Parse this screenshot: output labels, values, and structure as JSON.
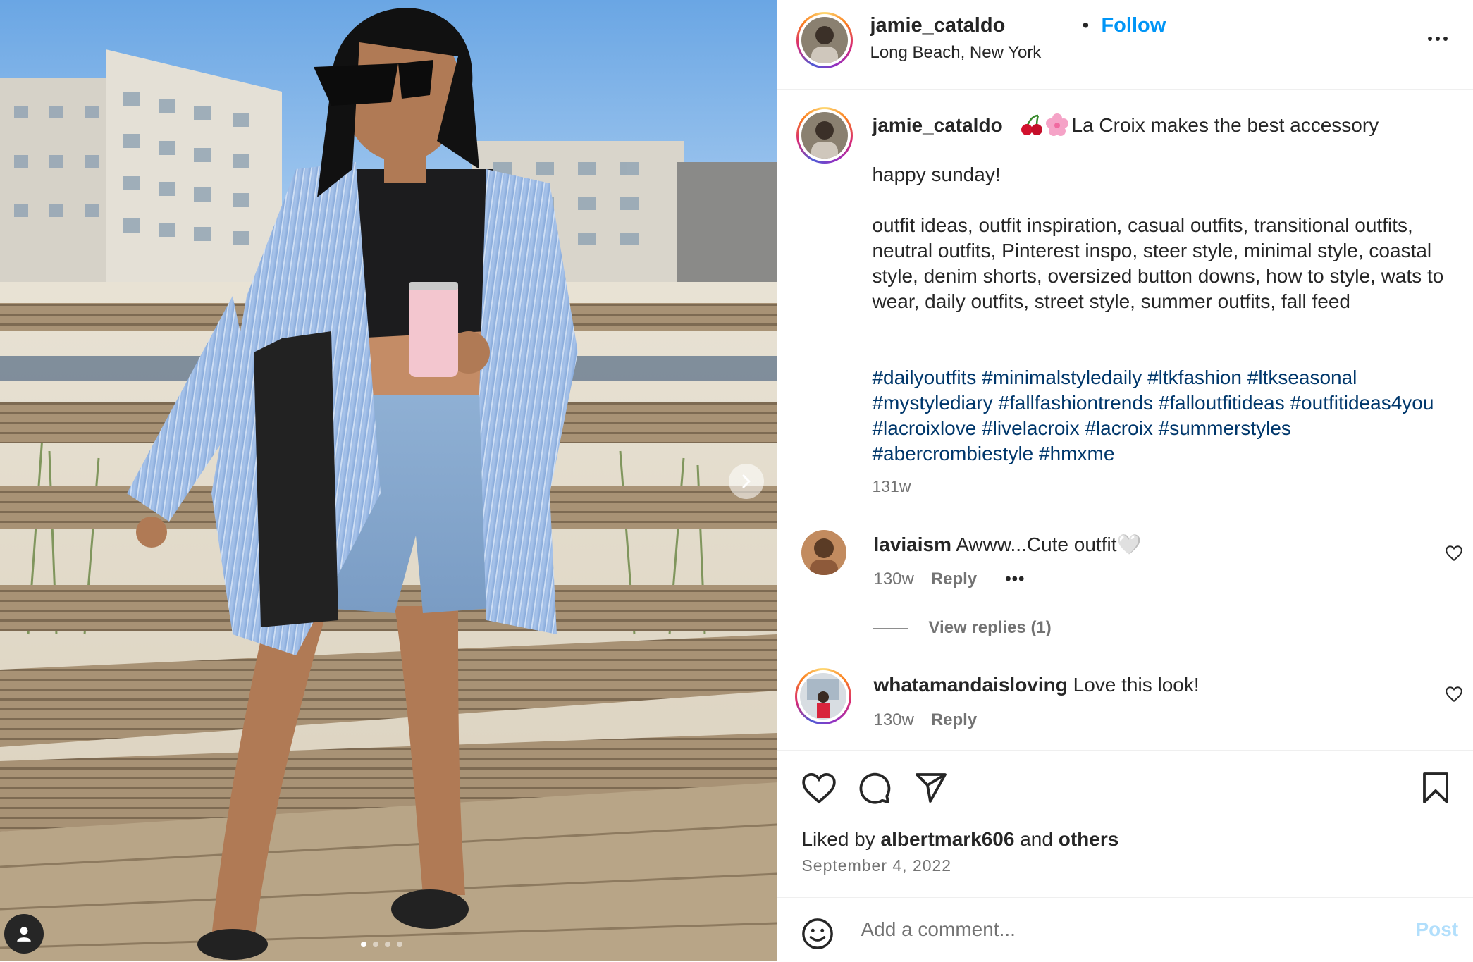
{
  "header": {
    "username": "jamie_cataldo",
    "separator": "•",
    "follow_label": "Follow",
    "location": "Long Beach, New York"
  },
  "caption": {
    "username": "jamie_cataldo",
    "emojis": [
      "cherries",
      "cherry-blossom"
    ],
    "title": "La Croix makes the best accessory",
    "line1": "happy sunday!",
    "paragraph": "outfit ideas, outfit inspiration, casual outfits, transitional outfits, neutral outfits, Pinterest inspo, steer style, minimal style, coastal style, denim shorts, oversized button downs, how to style, wats to wear, daily outfits, street style, summer outfits, fall feed",
    "hashtags": [
      "#dailyoutfits",
      "#minimalstyledaily",
      "#ltkfashion",
      "#ltkseasonal",
      "#mystylediary",
      "#fallfashiontrends",
      "#falloutfitideas",
      "#outfitideas4you",
      "#lacroixlove",
      "#livelacroix",
      "#lacroix",
      "#summerstyles",
      "#abercrombiestyle",
      "#hmxme"
    ],
    "time": "131w"
  },
  "comments": [
    {
      "username": "laviaism",
      "text": "Awww...Cute outfit🤍",
      "time": "130w",
      "reply_label": "Reply",
      "more": "•••",
      "view_replies": "View replies (1)"
    },
    {
      "username": "whatamandaisloving",
      "text": "Love this look!",
      "time": "130w",
      "reply_label": "Reply"
    }
  ],
  "likes": {
    "prefix": "Liked by",
    "user": "albertmark606",
    "and": "and",
    "others": "others"
  },
  "date": "September 4, 2022",
  "add_comment": {
    "placeholder": "Add a comment...",
    "post_label": "Post"
  },
  "carousel": {
    "count": 4,
    "active": 0
  },
  "colors": {
    "link": "#0095f6",
    "hashtag": "#00376b",
    "muted": "#737373",
    "post_disabled": "#b2dffc"
  },
  "icons": [
    "next-arrow-icon",
    "user-tag-icon",
    "more-icon",
    "heart-icon",
    "comment-icon",
    "share-icon",
    "bookmark-icon",
    "emoji-icon"
  ]
}
